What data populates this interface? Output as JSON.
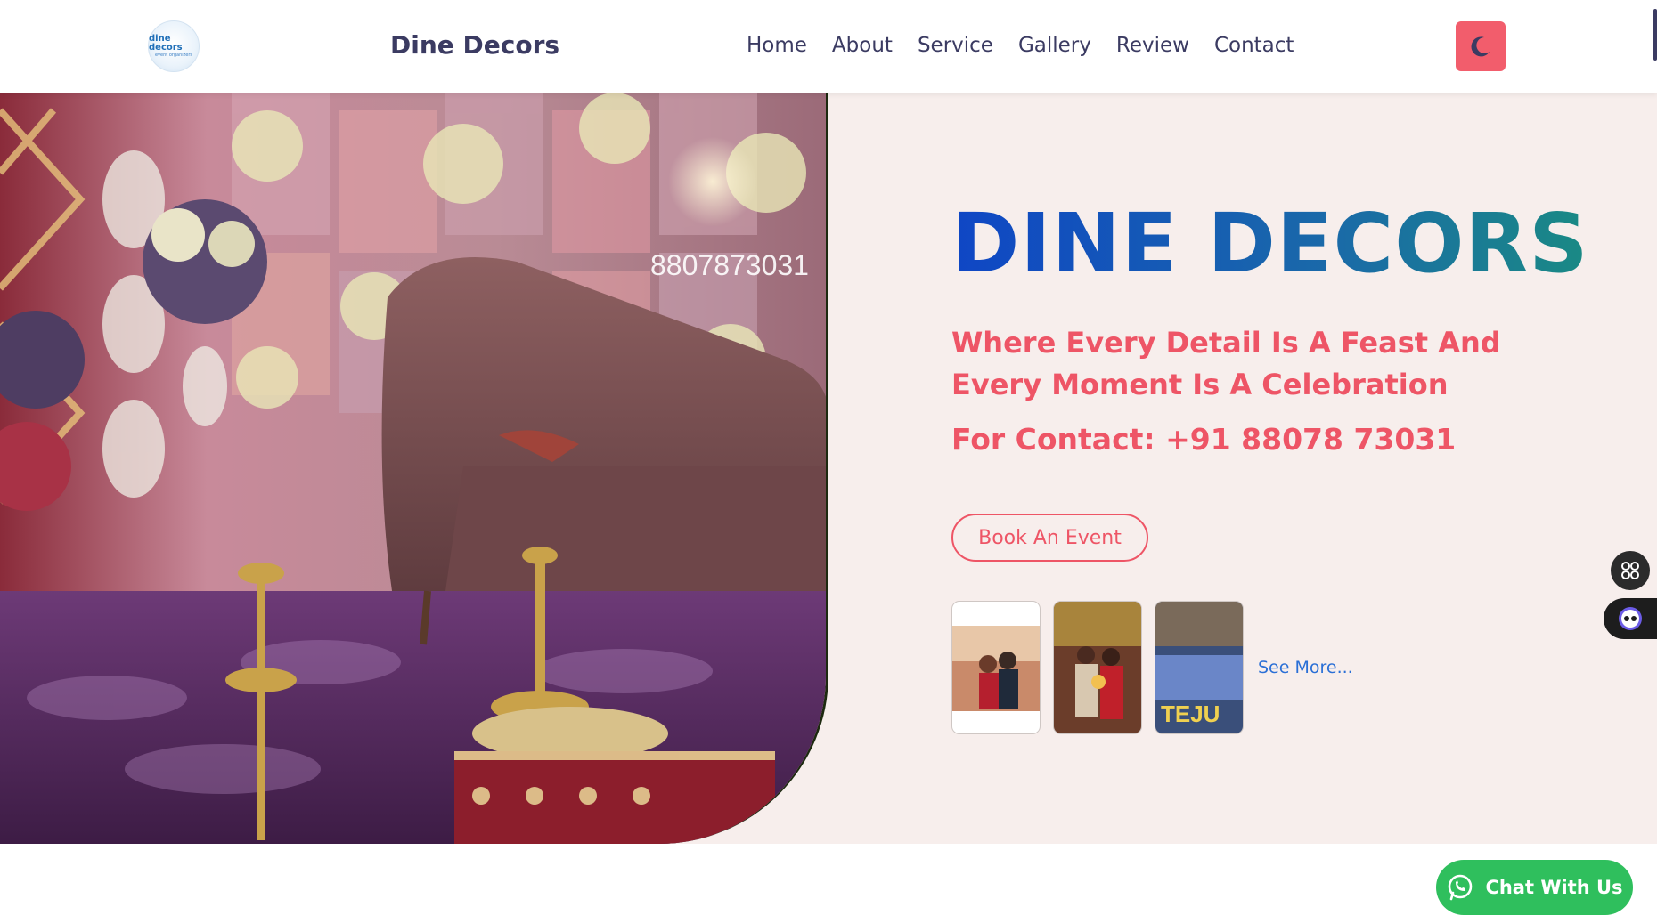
{
  "header": {
    "logo_text": "dine decors",
    "logo_subtext": "event organizers",
    "brand": "Dine Decors",
    "nav": [
      "Home",
      "About",
      "Service",
      "Gallery",
      "Review",
      "Contact"
    ],
    "theme_toggle_icon": "moon-icon"
  },
  "hero": {
    "image_overlay_phone": "8807873031",
    "title": "DINE DECORS",
    "tagline": "Where Every Detail Is A Feast And Every Moment Is A Celebration",
    "contact": "For Contact: +91 88078 73031",
    "book_button": "Book An Event",
    "thumbnail_text": "TEJU",
    "see_more": "See More..."
  },
  "floating": {
    "apps_icon": "apps-grid-icon",
    "assistant_icon": "assistant-face-icon",
    "chat_label": "Chat With Us",
    "chat_icon": "whatsapp-icon"
  },
  "colors": {
    "accent": "#ee5566",
    "brand_text": "#3b3b62",
    "title_gradient_start": "#0f46c5",
    "title_gradient_end": "#1a8a84",
    "hero_bg": "#f7eeec",
    "chat_green": "#2fbf5d"
  }
}
